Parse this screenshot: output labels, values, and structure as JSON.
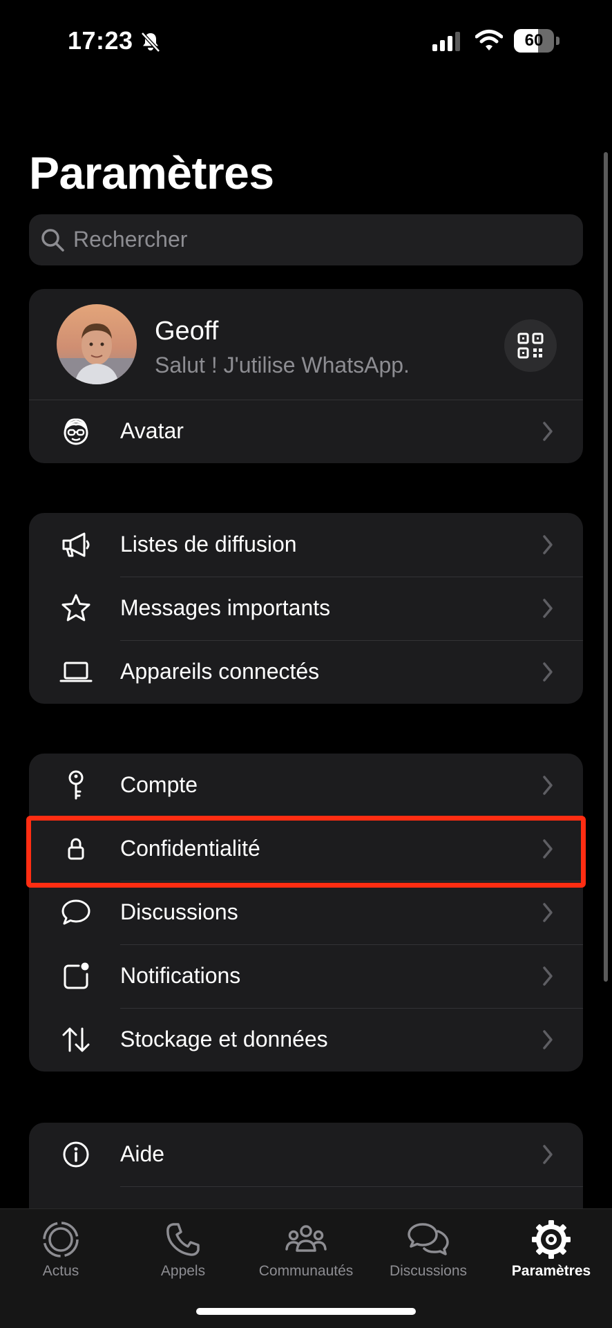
{
  "status_bar": {
    "time": "17:23",
    "battery": "60",
    "battery_level": 0.6
  },
  "header": {
    "title": "Paramètres"
  },
  "search": {
    "placeholder": "Rechercher"
  },
  "profile": {
    "name": "Geoff",
    "status": "Salut ! J'utilise WhatsApp."
  },
  "groups": {
    "profile_extra": [
      {
        "label": "Avatar",
        "icon": "avatar-icon"
      }
    ],
    "tools": [
      {
        "label": "Listes de diffusion",
        "icon": "megaphone-icon"
      },
      {
        "label": "Messages importants",
        "icon": "star-icon"
      },
      {
        "label": "Appareils connectés",
        "icon": "laptop-icon"
      }
    ],
    "settings": [
      {
        "label": "Compte",
        "icon": "key-icon"
      },
      {
        "label": "Confidentialité",
        "icon": "lock-icon",
        "highlighted": true
      },
      {
        "label": "Discussions",
        "icon": "chat-bubble-icon"
      },
      {
        "label": "Notifications",
        "icon": "notification-icon"
      },
      {
        "label": "Stockage et données",
        "icon": "arrows-updown-icon"
      }
    ],
    "help": [
      {
        "label": "Aide",
        "icon": "info-icon"
      }
    ]
  },
  "tabs": [
    {
      "label": "Actus",
      "icon": "status-icon",
      "active": false
    },
    {
      "label": "Appels",
      "icon": "phone-icon",
      "active": false
    },
    {
      "label": "Communautés",
      "icon": "community-icon",
      "active": false
    },
    {
      "label": "Discussions",
      "icon": "chats-icon",
      "active": false
    },
    {
      "label": "Paramètres",
      "icon": "settings-gear-icon",
      "active": true
    }
  ],
  "colors": {
    "background": "#000000",
    "card": "#1c1c1e",
    "highlight_border": "#ff2d12",
    "secondary_text": "#8d8d92"
  }
}
